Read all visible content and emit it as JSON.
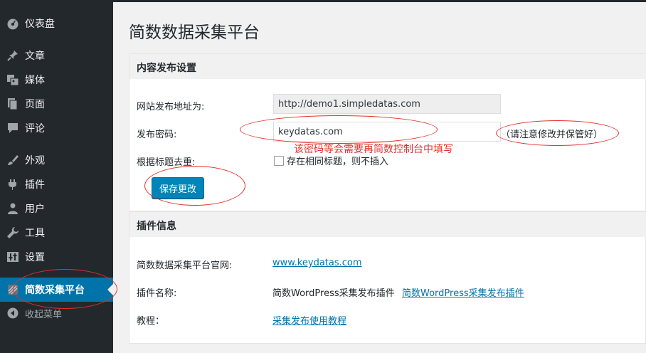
{
  "sidebar": {
    "items": [
      {
        "label": "仪表盘",
        "icon": "dashboard-icon"
      },
      {
        "label": "文章",
        "icon": "pin-icon"
      },
      {
        "label": "媒体",
        "icon": "media-icon"
      },
      {
        "label": "页面",
        "icon": "page-icon"
      },
      {
        "label": "评论",
        "icon": "comment-icon"
      },
      {
        "label": "外观",
        "icon": "brush-icon"
      },
      {
        "label": "插件",
        "icon": "plugin-icon"
      },
      {
        "label": "用户",
        "icon": "user-icon"
      },
      {
        "label": "工具",
        "icon": "wrench-icon"
      },
      {
        "label": "设置",
        "icon": "settings-icon"
      },
      {
        "label": "简数采集平台",
        "icon": "plugin-logo-icon",
        "active": true
      },
      {
        "label": "收起菜单",
        "icon": "collapse-icon"
      }
    ]
  },
  "page": {
    "title": "简数数据采集平台"
  },
  "publish_settings": {
    "heading": "内容发布设置",
    "url_label": "网站发布地址为:",
    "url_value": "http://demo1.simpledatas.com",
    "password_label": "发布密码:",
    "password_value": "keydatas.com",
    "password_hint": "（请注意修改并保管好）",
    "dedupe_label": "根据标题去重:",
    "dedupe_option": "存在相同标题，则不插入",
    "dedupe_checked": false,
    "save_button": "保存更改",
    "annotation_note": "该密码等会需要再简数控制台中填写"
  },
  "plugin_info": {
    "heading": "插件信息",
    "website_label": "简数数据采集平台官网:",
    "website_link": "www.keydatas.com",
    "name_label": "插件名称:",
    "name_value": "简数WordPress采集发布插件",
    "name_link": "简数WordPress采集发布插件",
    "tutorial_label": "教程：",
    "tutorial_link": "采集发布使用教程"
  },
  "colors": {
    "sidebar_bg": "#23282d",
    "active_bg": "#0073aa",
    "button_bg": "#0085ba",
    "annotation": "#e4302a",
    "link": "#0073aa"
  }
}
